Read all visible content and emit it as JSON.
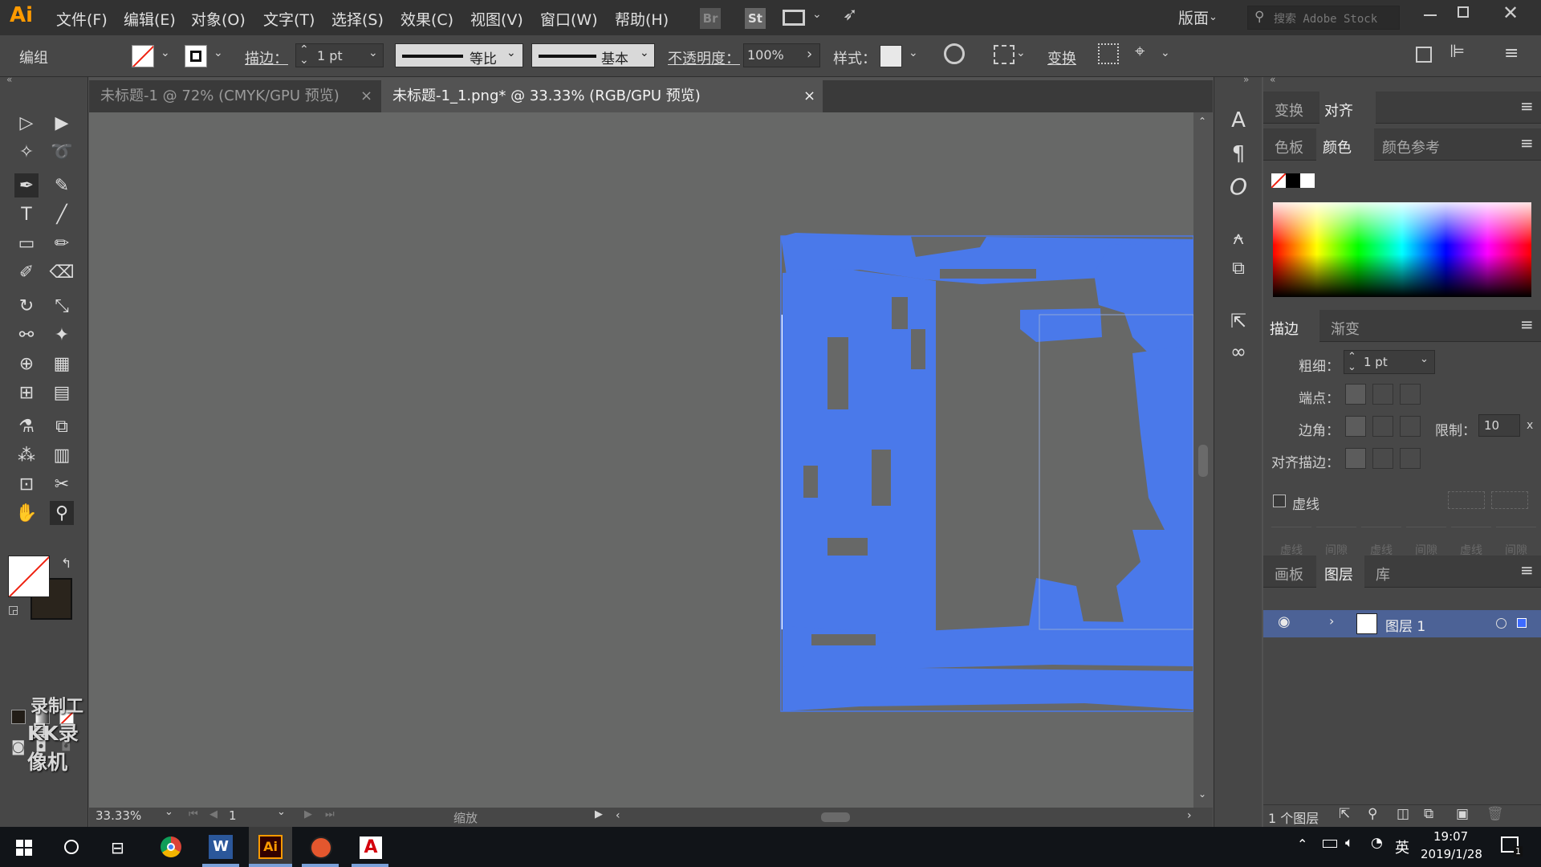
{
  "app": {
    "logo": "Ai",
    "workspace": "版面",
    "search_placeholder": "搜索 Adobe Stock",
    "bridge": "Br",
    "stock": "St"
  },
  "menu": [
    "文件(F)",
    "编辑(E)",
    "对象(O)",
    "文字(T)",
    "选择(S)",
    "效果(C)",
    "视图(V)",
    "窗口(W)",
    "帮助(H)"
  ],
  "control": {
    "selection_label": "编组",
    "stroke_label": "描边：",
    "stroke_weight": "1 pt",
    "profile_label": "等比",
    "brush_label": "基本",
    "opacity_label": "不透明度：",
    "opacity_value": "100%",
    "style_label": "样式：",
    "transform_label": "变换"
  },
  "tabs": [
    {
      "label": "未标题-1 @ 72% (CMYK/GPU 预览)",
      "active": false
    },
    {
      "label": "未标题-1_1.png* @ 33.33% (RGB/GPU 预览)",
      "active": true
    }
  ],
  "status": {
    "zoom": "33.33%",
    "artboard": "1",
    "tool_name": "缩放"
  },
  "watermark": [
    "录制工具",
    "KK录像机"
  ],
  "panels": {
    "top_tabs": [
      "变换",
      "对齐"
    ],
    "color_tabs": [
      "色板",
      "颜色",
      "颜色参考"
    ],
    "stroke_tabs": [
      "描边",
      "渐变"
    ],
    "stroke": {
      "weight_label": "粗细：",
      "weight_value": "1 pt",
      "cap_label": "端点：",
      "corner_label": "边角：",
      "limit_label": "限制：",
      "limit_value": "10",
      "limit_unit": "x",
      "align_label": "对齐描边：",
      "dashed_label": "虚线",
      "dash_fields": [
        "虚线",
        "间隙",
        "虚线",
        "间隙",
        "虚线",
        "间隙"
      ]
    },
    "layers_tabs": [
      "画板",
      "图层",
      "库"
    ],
    "layer_name": "图层 1",
    "layer_count": "1 个图层"
  },
  "taskbar": {
    "time": "19:07",
    "date": "2019/1/28",
    "ime": "英",
    "notif_count": "1"
  },
  "colors": {
    "accent_blue": "#4a79ea",
    "menubar": "#323232",
    "panel": "#474747",
    "canvas": "#676867"
  }
}
